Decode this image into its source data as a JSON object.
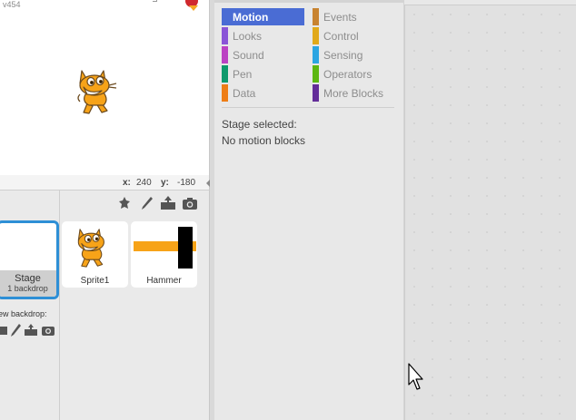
{
  "stage": {
    "version": "v454"
  },
  "coords": {
    "x_label": "x:",
    "x_value": "240",
    "y_label": "y:",
    "y_value": "-180"
  },
  "sprites_pane": {
    "stage_tile": {
      "label": "Stage",
      "backdrop_count": "1 backdrop"
    },
    "new_backdrop_label": "ew backdrop:",
    "sprites": [
      {
        "name": "Sprite1"
      },
      {
        "name": "Hammer"
      }
    ]
  },
  "palette": {
    "categories_left": [
      {
        "label": "Motion",
        "color": "#4a6cd4",
        "active": true
      },
      {
        "label": "Looks",
        "color": "#8a55d7"
      },
      {
        "label": "Sound",
        "color": "#bb42c3"
      },
      {
        "label": "Pen",
        "color": "#0e9a6c"
      },
      {
        "label": "Data",
        "color": "#ee7d16"
      }
    ],
    "categories_right": [
      {
        "label": "Events",
        "color": "#c88330"
      },
      {
        "label": "Control",
        "color": "#e1a91a"
      },
      {
        "label": "Sensing",
        "color": "#2ca5e2"
      },
      {
        "label": "Operators",
        "color": "#5cb712"
      },
      {
        "label": "More Blocks",
        "color": "#632d99"
      }
    ],
    "message_line1": "Stage selected:",
    "message_line2": "No motion blocks"
  },
  "colors": {
    "selected_border": "#2e8fd6",
    "stop_red": "#d0282e",
    "hammer_orange": "#f7a318"
  }
}
